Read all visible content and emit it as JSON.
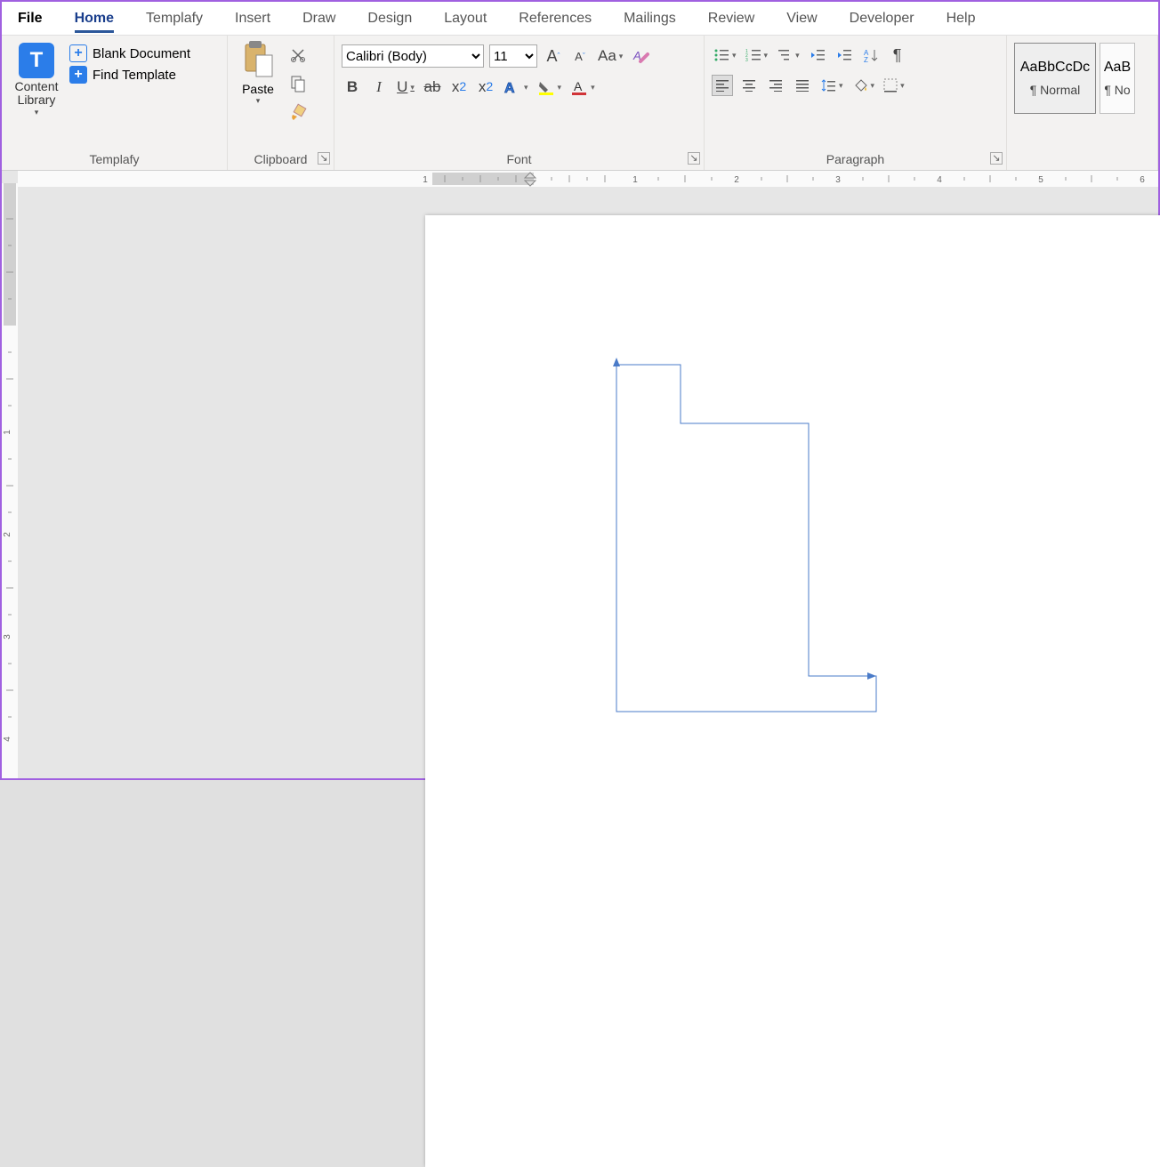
{
  "tabs": {
    "file": "File",
    "home": "Home",
    "templafy": "Templafy",
    "insert": "Insert",
    "draw": "Draw",
    "design": "Design",
    "layout": "Layout",
    "references": "References",
    "mailings": "Mailings",
    "review": "Review",
    "view": "View",
    "developer": "Developer",
    "help": "Help"
  },
  "templafy_group": {
    "content_library": "Content Library",
    "blank_document": "Blank Document",
    "find_template": "Find Template",
    "label": "Templafy",
    "t_letter": "T"
  },
  "clipboard": {
    "paste_label": "Paste",
    "label": "Clipboard"
  },
  "font": {
    "name_value": "Calibri (Body)",
    "size_value": "11",
    "label": "Font"
  },
  "paragraph": {
    "label": "Paragraph"
  },
  "styles": {
    "normal_sample": "AaBbCcDc",
    "normal_name": "¶ Normal",
    "nospacing_sample": "AaB",
    "nospacing_name": "¶ No"
  },
  "ruler": {
    "marks_h": [
      "1",
      "1",
      "2",
      "3",
      "4",
      "5",
      "6"
    ],
    "marks_v": [
      "1",
      "2",
      "3",
      "4"
    ]
  }
}
